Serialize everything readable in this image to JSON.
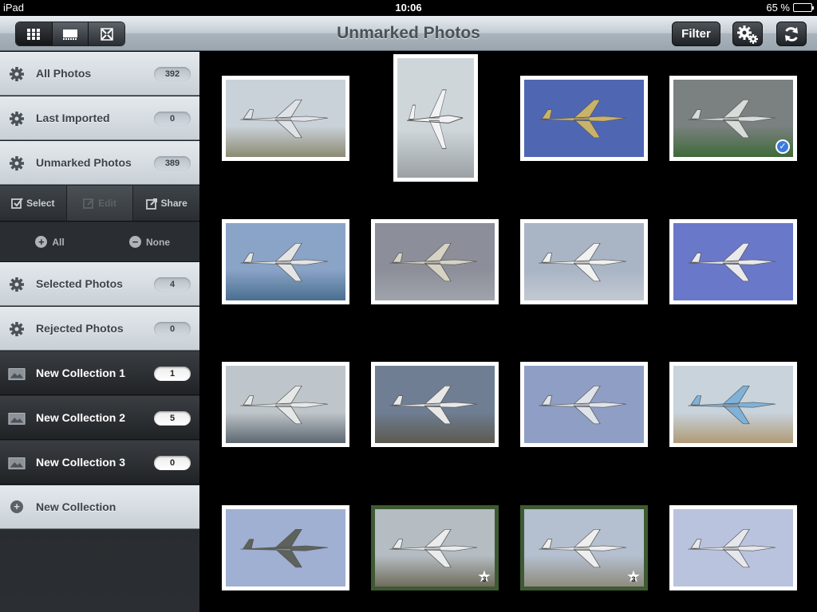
{
  "status": {
    "device": "iPad",
    "time": "10:06",
    "battery": "65 %",
    "battery_level": 0.65
  },
  "nav": {
    "title": "Unmarked Photos",
    "filter_label": "Filter",
    "view_modes": [
      "grid-view-icon",
      "filmstrip-view-icon",
      "fullscreen-view-icon"
    ],
    "settings_icon": "gears-icon",
    "refresh_icon": "refresh-icon"
  },
  "sidebar": {
    "albums": [
      {
        "label": "All Photos",
        "count": "392",
        "icon": "gear-icon"
      },
      {
        "label": "Last Imported",
        "count": "0",
        "icon": "gear-icon"
      },
      {
        "label": "Unmarked Photos",
        "count": "389",
        "icon": "gear-icon"
      }
    ],
    "tools": [
      {
        "label": "Select",
        "icon": "checkbox-icon",
        "enabled": true
      },
      {
        "label": "Edit",
        "icon": "edit-icon",
        "enabled": false
      },
      {
        "label": "Share",
        "icon": "share-icon",
        "enabled": true
      }
    ],
    "select_all": "All",
    "select_none": "None",
    "smart": [
      {
        "label": "Selected Photos",
        "count": "4",
        "icon": "gear-icon"
      },
      {
        "label": "Rejected Photos",
        "count": "0",
        "icon": "gear-icon"
      }
    ],
    "collections": [
      {
        "label": "New Collection 1",
        "count": "1",
        "icon": "photo-icon"
      },
      {
        "label": "New Collection 2",
        "count": "5",
        "icon": "photo-icon"
      },
      {
        "label": "New Collection 3",
        "count": "0",
        "icon": "photo-icon"
      }
    ],
    "new_collection": "New Collection"
  },
  "photos": [
    {
      "sky": "#c9d2d8",
      "ground": "#8c8a73",
      "plane": "#dfe3e8",
      "marked": false,
      "selected": false,
      "rating": ""
    },
    {
      "sky": "#cfd6da",
      "ground": "#9aa0a3",
      "plane": "#f0f2f3",
      "marked": false,
      "selected": false,
      "rating": ""
    },
    {
      "sky": "#4f67b3",
      "ground": "#4f67b3",
      "plane": "#c9b36a",
      "marked": false,
      "selected": false,
      "rating": ""
    },
    {
      "sky": "#7a8180",
      "ground": "#3f6a3a",
      "plane": "#d8dcd9",
      "marked": false,
      "selected": true,
      "rating": ""
    },
    {
      "sky": "#8aa4c8",
      "ground": "#4a6f8f",
      "plane": "#e4e4e4",
      "marked": false,
      "selected": false,
      "rating": ""
    },
    {
      "sky": "#8c8f99",
      "ground": "#9fa3ab",
      "plane": "#d6d2c4",
      "marked": false,
      "selected": false,
      "rating": ""
    },
    {
      "sky": "#a9b4c4",
      "ground": "#c2c9d3",
      "plane": "#f1f1f1",
      "marked": false,
      "selected": false,
      "rating": ""
    },
    {
      "sky": "#6a78c9",
      "ground": "#6a78c9",
      "plane": "#e9e9ee",
      "marked": false,
      "selected": false,
      "rating": ""
    },
    {
      "sky": "#bfc6cb",
      "ground": "#5d6770",
      "plane": "#e6e8e8",
      "marked": false,
      "selected": false,
      "rating": ""
    },
    {
      "sky": "#6f7e93",
      "ground": "#5c5a4f",
      "plane": "#e8e8e8",
      "marked": false,
      "selected": false,
      "rating": ""
    },
    {
      "sky": "#8f9ec4",
      "ground": "#8f9ec4",
      "plane": "#dfe3ea",
      "marked": false,
      "selected": false,
      "rating": ""
    },
    {
      "sky": "#c8d3dc",
      "ground": "#b09a76",
      "plane": "#7fb2d9",
      "marked": false,
      "selected": false,
      "rating": ""
    },
    {
      "sky": "#9fb0d2",
      "ground": "#9fb0d2",
      "plane": "#5d625a",
      "marked": false,
      "selected": false,
      "rating": ""
    },
    {
      "sky": "#b5bcc2",
      "ground": "#6f6d5c",
      "plane": "#e9ebec",
      "marked": true,
      "selected": false,
      "rating": "3"
    },
    {
      "sky": "#b4bfcf",
      "ground": "#8f8b7e",
      "plane": "#eeeeee",
      "marked": true,
      "selected": false,
      "rating": "3"
    },
    {
      "sky": "#b9c3de",
      "ground": "#b9c3de",
      "plane": "#e5e7ec",
      "marked": false,
      "selected": false,
      "rating": ""
    }
  ]
}
